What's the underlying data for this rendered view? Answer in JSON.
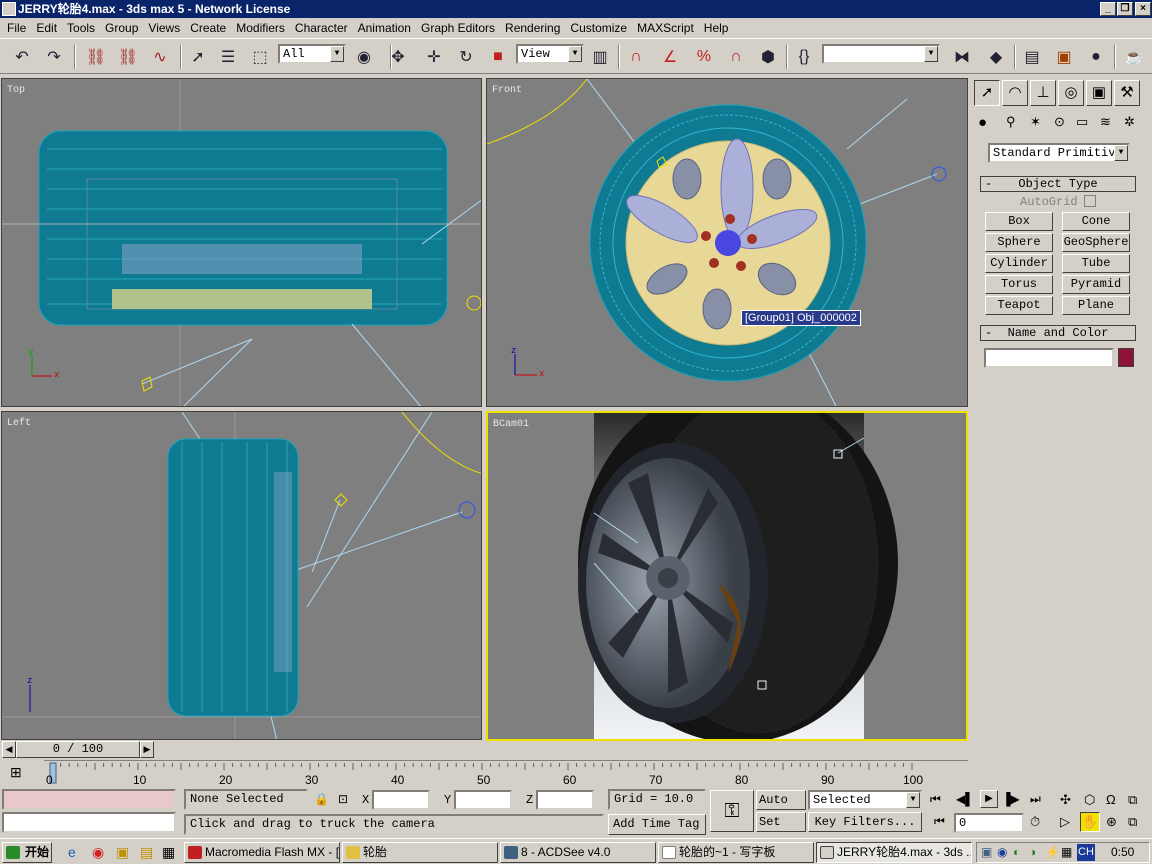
{
  "window": {
    "title": "JERRY轮胎4.max - 3ds max 5 - Network License"
  },
  "menu": [
    "File",
    "Edit",
    "Tools",
    "Group",
    "Views",
    "Create",
    "Modifiers",
    "Character",
    "Animation",
    "Graph Editors",
    "Rendering",
    "Customize",
    "MAXScript",
    "Help"
  ],
  "toolbar": {
    "selection_filter": "All",
    "ref_coord": "View",
    "named_sel": ""
  },
  "viewports": {
    "top": {
      "label": "Top"
    },
    "front": {
      "label": "Front",
      "tooltip": "[Group01] Obj_000002"
    },
    "left": {
      "label": "Left"
    },
    "camera": {
      "label": "BCam01"
    }
  },
  "axis": {
    "x": "x",
    "y": "y",
    "z": "z"
  },
  "command_panel": {
    "category": "Standard Primitiv",
    "object_type_title": "Object Type",
    "autogrid_label": "AutoGrid",
    "buttons": [
      "Box",
      "Cone",
      "Sphere",
      "GeoSphere",
      "Cylinder",
      "Tube",
      "Torus",
      "Pyramid",
      "Teapot",
      "Plane"
    ],
    "name_color_title": "Name and Color",
    "object_name": "",
    "object_color": "#8c1238",
    "collapse_symbol": "-"
  },
  "timeline": {
    "slider_text": "0 / 100",
    "ticks": [
      "0",
      "10",
      "20",
      "30",
      "40",
      "50",
      "60",
      "70",
      "80",
      "90",
      "100"
    ]
  },
  "status": {
    "selection": "None Selected",
    "x_label": "X:",
    "y_label": "Y:",
    "z_label": "Z:",
    "grid": "Grid = 10.0",
    "prompt": "Click and drag to truck the camera",
    "add_time_tag": "Add Time Tag",
    "auto_key": "Auto Key",
    "set_key": "Set Key",
    "key_mode": "Selected",
    "key_filters": "Key Filters...",
    "frame": "0"
  },
  "taskbar": {
    "start": "开始",
    "tasks": [
      "Macromedia Flash MX - [...",
      "轮胎",
      "8 - ACDSee v4.0",
      "轮胎的~1 - 写字板",
      "JERRY轮胎4.max - 3ds ..."
    ],
    "ime": "CH",
    "clock": "0:50"
  }
}
